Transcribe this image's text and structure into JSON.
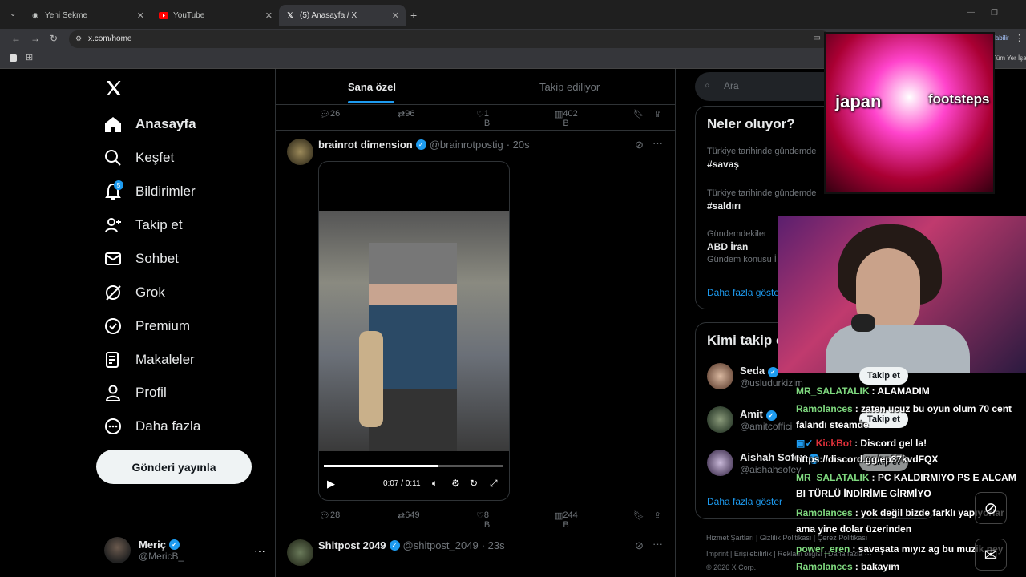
{
  "browser": {
    "tabs": [
      {
        "title": "Yeni Sekme",
        "icon": "chrome-icon"
      },
      {
        "title": "YouTube",
        "icon": "youtube-icon"
      },
      {
        "title": "(5) Anasayfa / X",
        "icon": "x-icon"
      }
    ],
    "url": "x.com/home",
    "bookmark_hint": "Tüm Yer İşaretleri",
    "signin_hint": "labilir"
  },
  "sidebar": {
    "logo": "X",
    "items": [
      {
        "label": "Anasayfa",
        "icon": "home-icon"
      },
      {
        "label": "Keşfet",
        "icon": "search-icon"
      },
      {
        "label": "Bildirimler",
        "icon": "bell-icon",
        "badge": "5"
      },
      {
        "label": "Takip et",
        "icon": "follow-icon"
      },
      {
        "label": "Sohbet",
        "icon": "mail-icon"
      },
      {
        "label": "Grok",
        "icon": "grok-icon"
      },
      {
        "label": "Premium",
        "icon": "premium-icon"
      },
      {
        "label": "Makaleler",
        "icon": "articles-icon"
      },
      {
        "label": "Profil",
        "icon": "profile-icon"
      },
      {
        "label": "Daha fazla",
        "icon": "more-icon"
      }
    ],
    "post_button": "Gönderi yayınla",
    "account": {
      "name": "Meriç",
      "handle": "@MericB_",
      "more": "···"
    }
  },
  "feed": {
    "tabs": [
      "Sana özel",
      "Takip ediliyor"
    ],
    "prev_actions": {
      "replies": "26",
      "reposts": "96",
      "likes": "1 B",
      "views": "402 B"
    },
    "tweets": [
      {
        "name": "brainrot dimension",
        "handle": "@brainrotpostig",
        "time": "· 20s",
        "video_time": "0:07 / 0:11",
        "actions": {
          "replies": "28",
          "reposts": "649",
          "likes": "8 B",
          "views": "244 B"
        }
      },
      {
        "name": "Shitpost 2049",
        "handle": "@shitpost_2049",
        "time": "· 23s"
      }
    ]
  },
  "right": {
    "search_placeholder": "Ara",
    "trends_title": "Neler oluyor?",
    "trends": [
      {
        "context": "Türkiye tarihinde gündemde",
        "name": "#savaş"
      },
      {
        "context": "Türkiye tarihinde gündemde",
        "name": "#saldırı"
      },
      {
        "context": "Gündemdekiler",
        "name": "ABD İran",
        "sub": "Gündem konusu  İ"
      }
    ],
    "show_more": "Daha fazla göster",
    "follow_title": "Kimi takip e",
    "follow": [
      {
        "name": "Seda",
        "handle": "@usludurkizim"
      },
      {
        "name": "Amit",
        "handle": "@amitcoffici"
      },
      {
        "name": "Aishah Sofey",
        "handle": "@aishahsofey"
      }
    ],
    "follow_btn": "Takip et",
    "show_more2": "Daha fazla göster",
    "footer": [
      "Hizmet Şartları  |  Gizlilik Politikası  |  Çerez Politikası",
      "Imprint  |  Erişilebilirlik  |  Reklam bilgisi  |  Daha fazla ···",
      "© 2026 X Corp."
    ]
  },
  "overlay": {
    "meme_left": "japan",
    "meme_right": "footsteps",
    "chat": [
      {
        "user": "MR_SALATALIK",
        "color": "#7fd97f",
        "msg": ": ALAMADIM"
      },
      {
        "user": "Ramolances",
        "color": "#7fd97f",
        "msg": ": zaten ucuz bu oyun olum 70 cent falandı steamde"
      },
      {
        "user": "KickBot",
        "color": "#e0303a",
        "msg": ": Discord gel la! https://discord.gg/ep37kvdFQX"
      },
      {
        "user": "MR_SALATALIK",
        "color": "#7fd97f",
        "msg": ": PC KALDIRMIYO PS E ALCAM BI TÜRLÜ İNDİRİME GİRMİYO"
      },
      {
        "user": "Ramolances",
        "color": "#7fd97f",
        "msg": ": yok değil bizde farklı yapıyorlar ama yine dolar üzerinden"
      },
      {
        "user": "power_eren",
        "color": "#7fd97f",
        "msg": ": savaşata mıyız ag bu muzik ney"
      },
      {
        "user": "Ramolances",
        "color": "#7fd97f",
        "msg": ": bakayım"
      }
    ]
  }
}
